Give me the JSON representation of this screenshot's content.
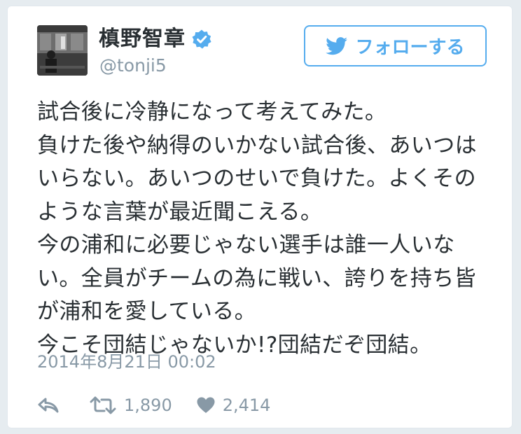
{
  "user": {
    "display_name": "槙野智章",
    "handle": "@tonji5",
    "verified": true
  },
  "follow_button": {
    "label": "フォローする"
  },
  "tweet": {
    "text": "試合後に冷静になって考えてみた。\n負けた後や納得のいかない試合後、あいつは\nいらない。あいつのせいで負けた。よくその\nような言葉が最近聞こえる。\n今の浦和に必要じゃない選手は誰一人いな\nい。全員がチームの為に戦い、誇りを持ち皆\nが浦和を愛している。\n今こそ団結じゃないか!?団結だぞ団結。",
    "timestamp": "2014年8月21日 00:02"
  },
  "actions": {
    "retweets": "1,890",
    "likes": "2,414"
  },
  "colors": {
    "accent": "#55acee",
    "text": "#292f33",
    "muted": "#8899a6",
    "verified": "#55acee"
  },
  "icons": [
    "twitter-bird-icon",
    "verified-badge-icon",
    "reply-icon",
    "retweet-icon",
    "heart-icon"
  ]
}
